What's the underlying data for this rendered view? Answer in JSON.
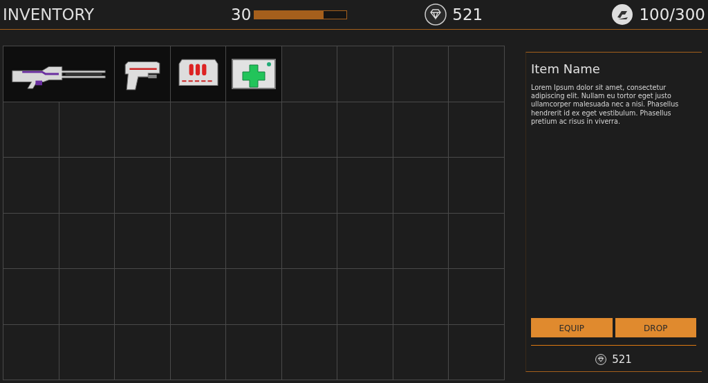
{
  "header": {
    "title": "INVENTORY",
    "level_text": "30",
    "xp": {
      "level": 0.75
    },
    "gems": "521",
    "capacity": "100/300"
  },
  "grid": {
    "items": [
      {
        "kind": "rifle"
      },
      {
        "kind": "pistol"
      },
      {
        "kind": "ammo"
      },
      {
        "kind": "medkit"
      }
    ]
  },
  "detail": {
    "name": "Item Name",
    "description": "Lorem Ipsum dolor sit amet, consectetur adipiscing elit. Nullam eu tortor eget justo ullamcorper malesuada nec a nisi. Phasellus hendrerit id ex eget vestibulum. Phasellus pretium ac risus in viverra.",
    "buttons": [
      "EQUIP",
      "DROP"
    ],
    "price": "521"
  }
}
